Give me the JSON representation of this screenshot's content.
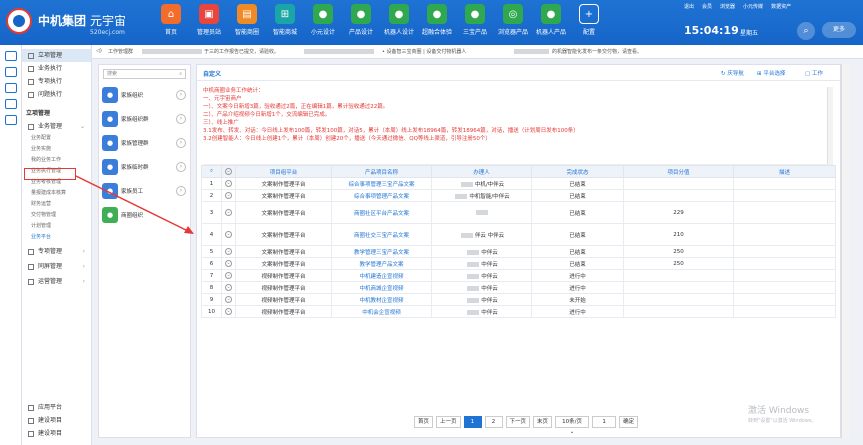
{
  "header": {
    "brand": "中机集团",
    "subbrand": "元宇宙",
    "domain": "520ecj.com",
    "nav": [
      {
        "label": "首页",
        "icon": "home-icon",
        "color": "#f26c2c",
        "glyph": "⌂"
      },
      {
        "label": "管理员站",
        "icon": "admin-icon",
        "color": "#e8453c",
        "glyph": "▣"
      },
      {
        "label": "智能商圈",
        "icon": "business-icon",
        "color": "#f08a24",
        "glyph": "▤"
      },
      {
        "label": "智能商城",
        "icon": "mall-icon",
        "color": "#1aa6a6",
        "glyph": "⊞"
      },
      {
        "label": "小元设计",
        "icon": "robot-design-icon",
        "color": "#2fa84f",
        "glyph": "●"
      },
      {
        "label": "产品设计",
        "icon": "product-design-icon",
        "color": "#2fa84f",
        "glyph": "●"
      },
      {
        "label": "机器人设计",
        "icon": "robot-icon",
        "color": "#2fa84f",
        "glyph": "●"
      },
      {
        "label": "超融合体验",
        "icon": "experience-icon",
        "color": "#2fa84f",
        "glyph": "●"
      },
      {
        "label": "三宝产品",
        "icon": "treasure-icon",
        "color": "#2fa84f",
        "glyph": "●"
      },
      {
        "label": "浏览器产品",
        "icon": "browser-icon",
        "color": "#2fa84f",
        "glyph": "◎"
      },
      {
        "label": "机器人产品",
        "icon": "robot-product-icon",
        "color": "#2fa84f",
        "glyph": "●"
      },
      {
        "label": "配置",
        "icon": "plus-icon",
        "color": "#1565c8",
        "glyph": "+"
      }
    ],
    "links": [
      "退出",
      "会员",
      "浏览器",
      "小元传媒",
      "数据资产"
    ],
    "time": "15:04:19",
    "weekday": "星期五",
    "more": "更多"
  },
  "sidebar": {
    "items": [
      {
        "label": "立项管理",
        "type": "head"
      },
      {
        "label": "业务执行",
        "type": "item"
      },
      {
        "label": "专项执行",
        "type": "item"
      },
      {
        "label": "问题执行",
        "type": "item"
      }
    ],
    "section": "立项管理",
    "group": "业务管理",
    "subs": [
      "业务配置",
      "业务实施",
      "我的业务工作",
      "业务执行管理",
      "业务考核管理",
      "量报建成本核算",
      "财务运营",
      "交付物管理",
      "计划管理",
      "业务平台"
    ],
    "groups2": [
      "专项管理",
      "同屏管理",
      "运营管理"
    ],
    "bottom": [
      "应用平台",
      "建设项目",
      "建设项目"
    ]
  },
  "tabbar": {
    "text1": "工作管理群",
    "text2": "于三的工作报告已提交，请验收。",
    "text3": "• 设备智三宝商圈 | 设备交付物机器人",
    "text4": "的机器智能化发布一条交付物，请查看。"
  },
  "orgpanel": {
    "search_placeholder": "搜索",
    "orgs": [
      {
        "label": "家族组织",
        "color": "#3b7ddb"
      },
      {
        "label": "家族组织群",
        "color": "#3b7ddb"
      },
      {
        "label": "家族管理群",
        "color": "#3b7ddb"
      },
      {
        "label": "家族临时群",
        "color": "#3b7ddb"
      },
      {
        "label": "家族员工",
        "color": "#3b7ddb"
      },
      {
        "label": "商圈组织",
        "color": "#3fae55"
      }
    ]
  },
  "main": {
    "title": "自定义",
    "actions": [
      "庆导航",
      "平台选择",
      "工作"
    ],
    "notice": [
      "中机商圈业务工作统计：",
      "一、元宇宙商户",
      "一）、文案今日新增3篇，验收通过2篇，正在编辑1篇，累计验收通过22篇。",
      "二）、产品介绍视频今日新增1个，交流编辑已完成。",
      "三）、线上推广",
      "3.1发布、转发、对话：今日线上发布100篇，转发100篇，对话5，累计（本周）线上发布18964篇，转发18964篇，对话，播送（计划周日发布100条）",
      "3.2创建智能人：今日线上创建1个，累计（本周）创建20个，播送（今天通过微信、QQ等线上渠道，引导注册50个）"
    ],
    "columns": [
      "项目组平台",
      "产品项目名称",
      "办理人",
      "完成状态",
      "项目分值",
      "描述"
    ],
    "rows": [
      {
        "no": "1",
        "platform": "文案制作管理平台",
        "name": "综合事项管理三宝产品文案",
        "person": "中机/中伴云",
        "status": "已结束",
        "score": "",
        "desc": ""
      },
      {
        "no": "2",
        "platform": "文案制作管理平台",
        "name": "综合事项管理产品文案",
        "person": "中机智能/中伴云",
        "status": "已结束",
        "score": "",
        "desc": ""
      },
      {
        "no": "3",
        "platform": "文案制作管理平台",
        "name": "商圈社区平台产品文案",
        "person": "",
        "status": "已结束",
        "score": "229",
        "desc": ""
      },
      {
        "no": "4",
        "platform": "文案制作管理平台",
        "name": "商圈社交三宝产品文案",
        "person": "伴云 中伴云",
        "status": "已结束",
        "score": "210",
        "desc": ""
      },
      {
        "no": "5",
        "platform": "文案制作管理平台",
        "name": "教学管理三宝产品文案",
        "person": "中伴云",
        "status": "已结束",
        "score": "250",
        "desc": ""
      },
      {
        "no": "6",
        "platform": "文案制作管理平台",
        "name": "教学管理产品文案",
        "person": "中伴云",
        "status": "已结束",
        "score": "250",
        "desc": ""
      },
      {
        "no": "7",
        "platform": "视频制作管理平台",
        "name": "中机建造企宣视频",
        "person": "中伴云",
        "status": "进行中",
        "score": "",
        "desc": ""
      },
      {
        "no": "8",
        "platform": "视频制作管理平台",
        "name": "中机商城企宣视频",
        "person": "中伴云",
        "status": "进行中",
        "score": "",
        "desc": ""
      },
      {
        "no": "9",
        "platform": "视频制作管理平台",
        "name": "中机教材企宣视频",
        "person": "中伴云",
        "status": "未开始",
        "score": "",
        "desc": ""
      },
      {
        "no": "10",
        "platform": "视频制作管理平台",
        "name": "中机会企宣视频",
        "person": "中伴云",
        "status": "进行中",
        "score": "",
        "desc": ""
      }
    ],
    "pager": {
      "first": "首页",
      "prev": "上一页",
      "pages": [
        "1",
        "2"
      ],
      "next": "下一页",
      "last": "末页",
      "size": "10条/页",
      "goto_value": "1",
      "confirm": "确定"
    }
  },
  "watermark": {
    "title": "激活 Windows",
    "sub": "转到\"设置\"以激活 Windows。"
  }
}
